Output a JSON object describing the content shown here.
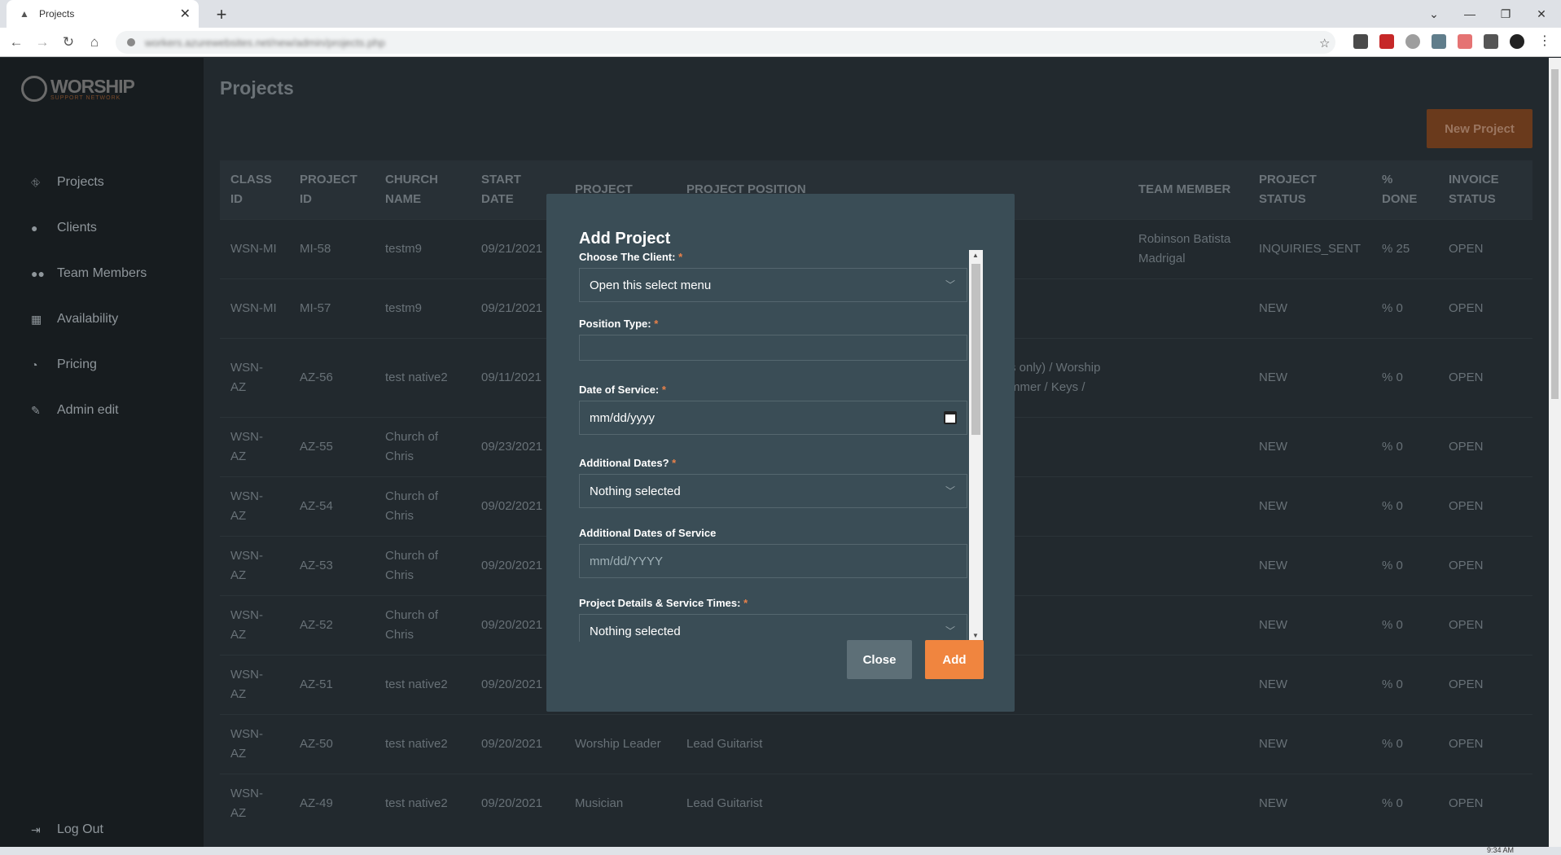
{
  "browser": {
    "tab_title": "Projects",
    "close_tab": "✕",
    "new_tab": "+",
    "url": "workers.azurewebsites.net/new/admin/projects.php"
  },
  "sidebar": {
    "logo_main": "WORSHIP",
    "logo_sub": "SUPPORT NETWORK",
    "items": [
      {
        "label": "Projects",
        "icon": "projects-icon"
      },
      {
        "label": "Clients",
        "icon": "user-icon"
      },
      {
        "label": "Team Members",
        "icon": "users-icon"
      },
      {
        "label": "Availability",
        "icon": "calendar-icon"
      },
      {
        "label": "Pricing",
        "icon": "pie-chart-icon"
      },
      {
        "label": "Admin edit",
        "icon": "pencil-icon"
      }
    ],
    "logout": "Log Out"
  },
  "main": {
    "title": "Projects",
    "new_button": "New Project",
    "columns": [
      "CLASS ID",
      "PROJECT ID",
      "CHURCH NAME",
      "START DATE",
      "PROJECT",
      "PROJECT POSITION",
      "TEAM MEMBER",
      "PROJECT STATUS",
      "% DONE",
      "INVOICE STATUS"
    ],
    "rows": [
      {
        "class_id": "WSN-MI",
        "project_id": "MI-58",
        "church": "testm9",
        "start": "09/21/2021",
        "project": "",
        "position": "",
        "member": "Robinson Batista Madrigal",
        "status": "INQUIRIES_SENT",
        "done": "% 25",
        "invoice": "OPEN"
      },
      {
        "class_id": "WSN-MI",
        "project_id": "MI-57",
        "church": "testm9",
        "start": "09/21/2021",
        "project": "",
        "position": "",
        "member": "",
        "status": "NEW",
        "done": "% 0",
        "invoice": "OPEN"
      },
      {
        "class_id": "WSN-AZ",
        "project_id": "AZ-56",
        "church": "test native2",
        "start": "09/11/2021",
        "project": "",
        "position": "s only) / Worship mmer / Keys /",
        "member": "",
        "status": "NEW",
        "done": "% 0",
        "invoice": "OPEN"
      },
      {
        "class_id": "WSN-AZ",
        "project_id": "AZ-55",
        "church": "Church of Chris",
        "start": "09/23/2021",
        "project": "",
        "position": "",
        "member": "",
        "status": "NEW",
        "done": "% 0",
        "invoice": "OPEN"
      },
      {
        "class_id": "WSN-AZ",
        "project_id": "AZ-54",
        "church": "Church of Chris",
        "start": "09/02/2021",
        "project": "",
        "position": "",
        "member": "",
        "status": "NEW",
        "done": "% 0",
        "invoice": "OPEN"
      },
      {
        "class_id": "WSN-AZ",
        "project_id": "AZ-53",
        "church": "Church of Chris",
        "start": "09/20/2021",
        "project": "",
        "position": "",
        "member": "",
        "status": "NEW",
        "done": "% 0",
        "invoice": "OPEN"
      },
      {
        "class_id": "WSN-AZ",
        "project_id": "AZ-52",
        "church": "Church of Chris",
        "start": "09/20/2021",
        "project": "",
        "position": "",
        "member": "",
        "status": "NEW",
        "done": "% 0",
        "invoice": "OPEN"
      },
      {
        "class_id": "WSN-AZ",
        "project_id": "AZ-51",
        "church": "test native2",
        "start": "09/20/2021",
        "project": "",
        "position": "",
        "member": "",
        "status": "NEW",
        "done": "% 0",
        "invoice": "OPEN"
      },
      {
        "class_id": "WSN-AZ",
        "project_id": "AZ-50",
        "church": "test native2",
        "start": "09/20/2021",
        "project": "Worship Leader",
        "position": "Lead Guitarist",
        "member": "",
        "status": "NEW",
        "done": "% 0",
        "invoice": "OPEN"
      },
      {
        "class_id": "WSN-AZ",
        "project_id": "AZ-49",
        "church": "test native2",
        "start": "09/20/2021",
        "project": "Musician",
        "position": "Lead Guitarist",
        "member": "",
        "status": "NEW",
        "done": "% 0",
        "invoice": "OPEN"
      }
    ]
  },
  "modal": {
    "title": "Add Project",
    "fields": [
      {
        "label": "Choose The Client:",
        "required": "*",
        "value": "Open this select menu"
      },
      {
        "label": "Position Type:",
        "required": "*",
        "value": ""
      },
      {
        "label": "Date of Service:",
        "required": "*",
        "value": "mm/dd/yyyy"
      },
      {
        "label": "Additional Dates?",
        "required": "*",
        "value": "Nothing selected"
      },
      {
        "label": "Additional Dates of Service",
        "required": "",
        "placeholder": "mm/dd/YYYY"
      },
      {
        "label": "Project Details & Service Times:",
        "required": "*",
        "value": "Nothing selected"
      }
    ],
    "close_button": "Close",
    "add_button": "Add"
  },
  "taskbar": {
    "clock": "9:34 AM"
  },
  "colors": {
    "accent": "#f0853f",
    "modal_bg": "#3a4d56",
    "sidebar_bg": "#171c1f"
  }
}
